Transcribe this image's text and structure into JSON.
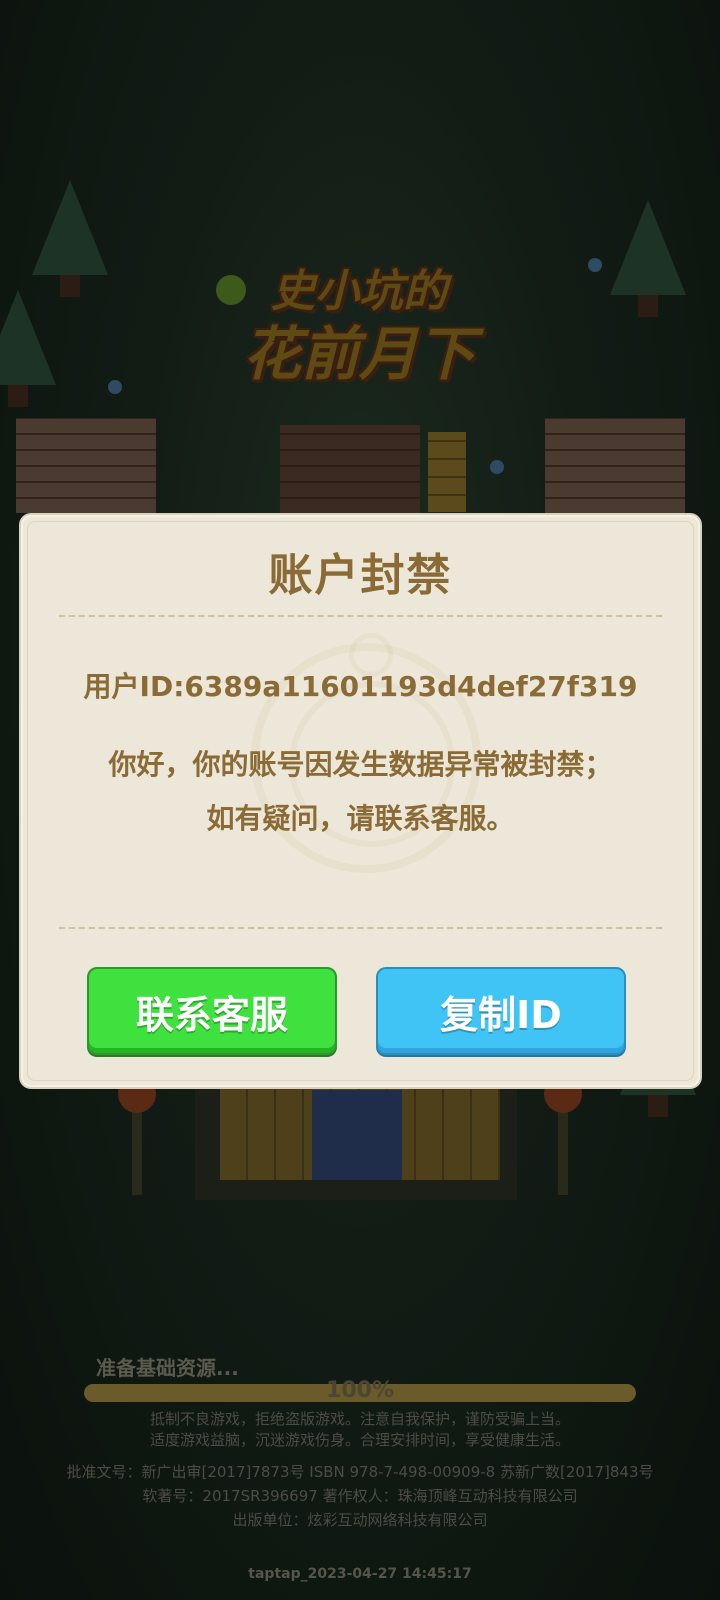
{
  "game_logo": {
    "line1": "史小坑的",
    "line2": "花前月下"
  },
  "dialog": {
    "title": "账户封禁",
    "user_id_label": "用户ID:6389a11601193d4def27f319",
    "message_line1": "你好，你的账号因发生数据异常被封禁；",
    "message_line2": "如有疑问，请联系客服。",
    "contact_button": "联系客服",
    "copy_id_button": "复制ID"
  },
  "loading": {
    "label": "准备基础资源...",
    "percent_text": "100%",
    "progress": 1.0
  },
  "notices": {
    "health_line1": "抵制不良游戏，拒绝盗版游戏。注意自我保护，谨防受骗上当。",
    "health_line2": "适度游戏益脑，沉迷游戏伤身。合理安排时间，享受健康生活。",
    "approval": "批准文号：新广出审[2017]7873号  ISBN 978-7-498-00909-8 苏新广数[2017]843号",
    "software_copyright": "软著号：2017SR396697  著作权人：珠海顶峰互动科技有限公司",
    "publisher": "出版单位：炫彩互动网络科技有限公司"
  },
  "timestamp": "taptap_2023-04-27 14:45:17",
  "colors": {
    "dialog_bg": "#ece7d8",
    "dialog_text": "#8a6b35",
    "contact_button": "#3ee13d",
    "copy_button": "#40c4f5"
  }
}
